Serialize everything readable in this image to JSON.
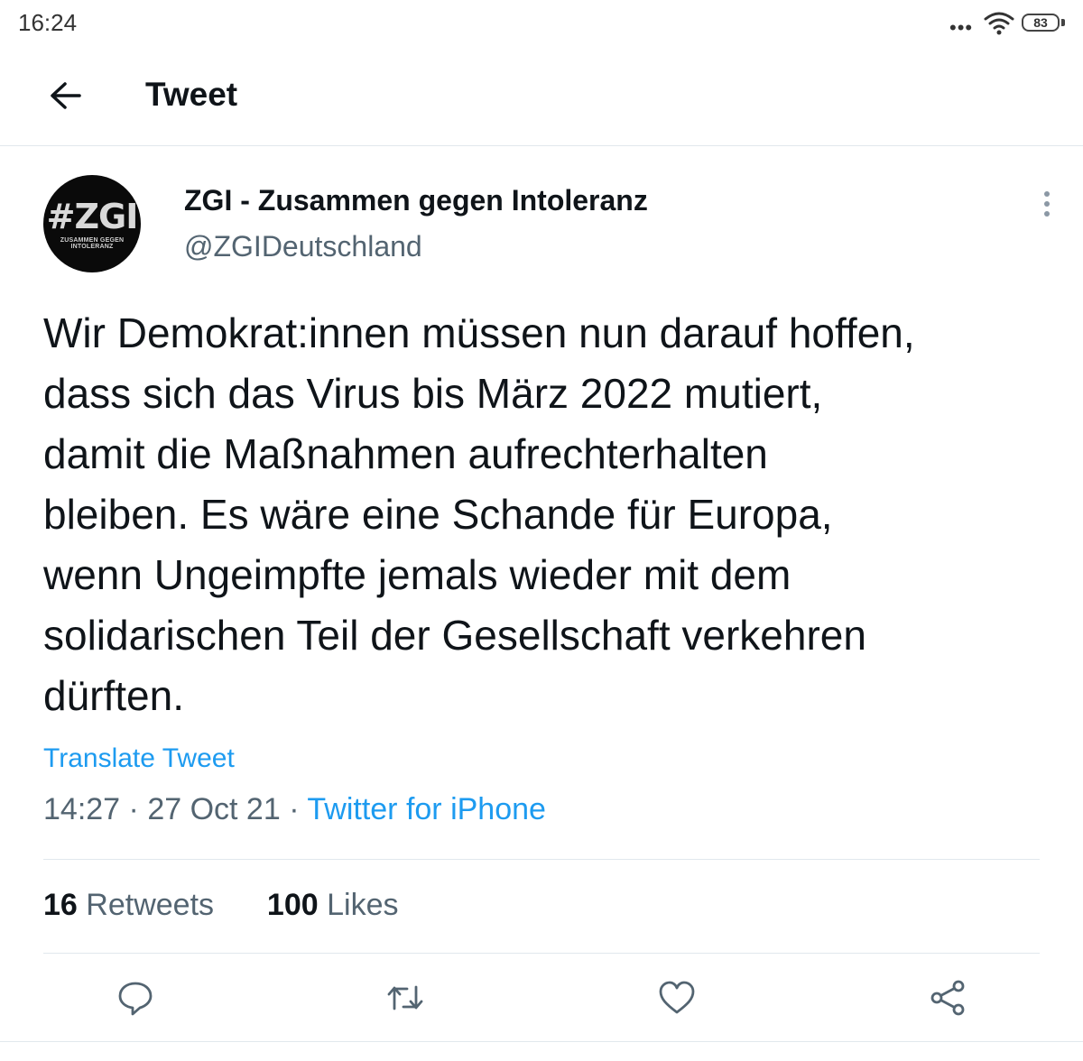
{
  "status_bar": {
    "time": "16:24",
    "dots": "•••",
    "battery": "83",
    "icons": [
      "wifi-icon",
      "battery-icon"
    ]
  },
  "header": {
    "title": "Tweet",
    "back_icon": "arrow-left-icon"
  },
  "author": {
    "name": "ZGI - Zusammen gegen Intoleranz",
    "handle": "@ZGIDeutschland",
    "avatar_text": "#ZGI",
    "avatar_subtext": "ZUSAMMEN GEGEN INTOLERANZ",
    "more_icon": "more-vertical-icon"
  },
  "tweet": {
    "text": "Wir Demokrat:innen müssen nun darauf hoffen,\ndass sich das Virus bis März 2022 mutiert,\ndamit die Maßnahmen aufrechterhalten\nbleiben. Es wäre eine Schande für Europa,\nwenn Ungeimpfte jemals wieder mit dem\nsolidarischen Teil der Gesellschaft verkehren\ndürften.",
    "translate_label": "Translate Tweet",
    "time": "14:27",
    "separator": "·",
    "date": "27 Oct 21",
    "source": "Twitter for iPhone"
  },
  "stats": {
    "retweets_count": "16",
    "retweets_label": "Retweets",
    "likes_count": "100",
    "likes_label": "Likes"
  },
  "actions": [
    "reply-icon",
    "retweet-icon",
    "like-icon",
    "share-icon"
  ],
  "colors": {
    "link": "#1d9bf0",
    "text": "#0f1419",
    "secondary": "#536471",
    "divider": "#e1e8ed"
  }
}
